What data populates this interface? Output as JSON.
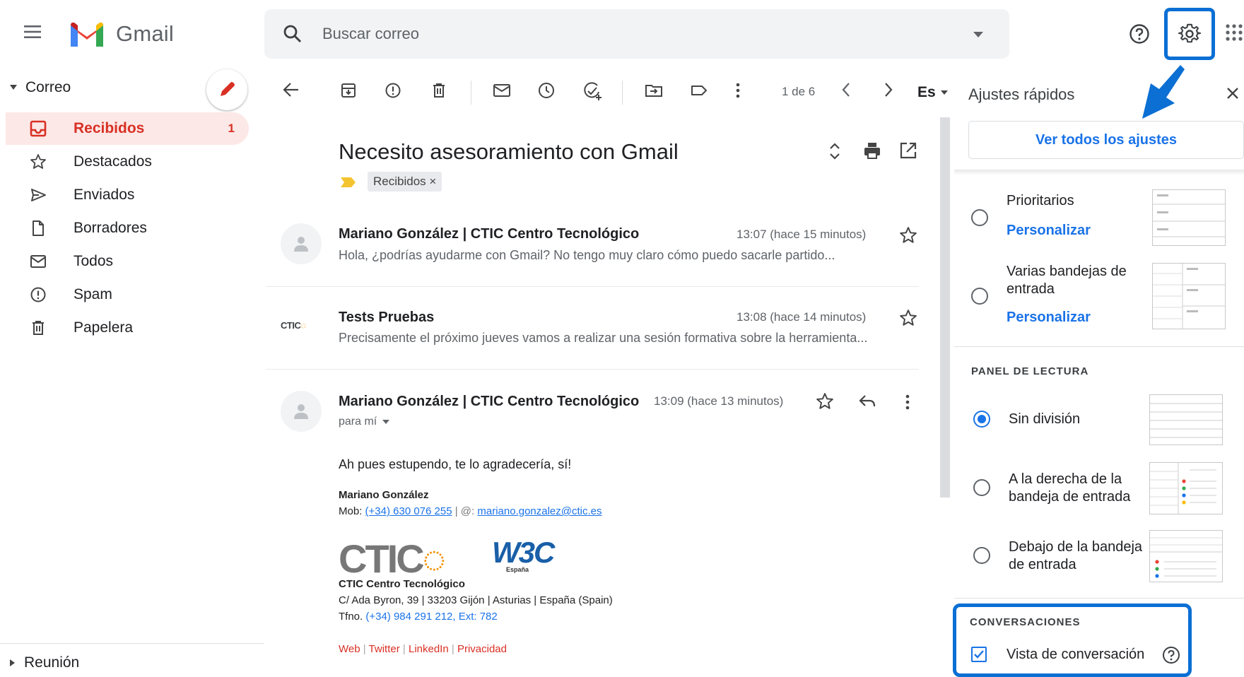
{
  "app": {
    "name": "Gmail"
  },
  "header": {
    "search_placeholder": "Buscar correo"
  },
  "sidebar": {
    "section_label": "Correo",
    "items": [
      {
        "label": "Recibidos",
        "count": "1",
        "icon": "inbox-icon",
        "active": true
      },
      {
        "label": "Destacados",
        "icon": "star-icon"
      },
      {
        "label": "Enviados",
        "icon": "send-icon"
      },
      {
        "label": "Borradores",
        "icon": "draft-icon"
      },
      {
        "label": "Todos",
        "icon": "all-mail-icon"
      },
      {
        "label": "Spam",
        "icon": "spam-icon"
      },
      {
        "label": "Papelera",
        "icon": "trash-icon"
      }
    ],
    "meet_label": "Reunión"
  },
  "toolbar": {
    "pager": "1 de 6",
    "language": "Es"
  },
  "thread": {
    "subject": "Necesito asesoramiento con Gmail",
    "label": "Recibidos ×",
    "messages": [
      {
        "sender": "Mariano González | CTIC Centro Tecnológico",
        "time": "13:07 (hace 15 minutos)",
        "snippet": "Hola, ¿podrías ayudarme con Gmail? No tengo muy claro cómo puedo sacarle partido..."
      },
      {
        "sender": "Tests Pruebas",
        "time": "13:08 (hace 14 minutos)",
        "snippet": "Precisamente el próximo jueves vamos a realizar una sesión formativa sobre la herramienta...",
        "avatar_text": "CTIC"
      },
      {
        "sender": "Mariano González | CTIC Centro Tecnológico",
        "time": "13:09 (hace 13 minutos)",
        "to": "para mí",
        "body": "Ah pues estupendo, te lo agradecería, sí!"
      }
    ],
    "signature": {
      "name": "Mariano González",
      "mob_label": "Mob:",
      "mob_phone": "(+34) 630 076 255",
      "at_sep": "| @:",
      "email": "mariano.gonzalez@ctic.es",
      "logo_text": "CTIC",
      "w3c_text": "W3C",
      "w3c_sub": "España",
      "org": "CTIC Centro Tecnológico",
      "address": "C/ Ada Byron, 39  | 33203 Gijón  |  Asturias  |  España (Spain)",
      "tfno_label": "Tfno.",
      "tfno": "(+34) 984 291 212, Ext: 782",
      "links": [
        "Web",
        "Twitter",
        "LinkedIn",
        "Privacidad"
      ]
    }
  },
  "quick_settings": {
    "title": "Ajustes rápidos",
    "see_all": "Ver todos los ajustes",
    "inbox_types": [
      {
        "label": "Prioritarios",
        "link": "Personalizar"
      },
      {
        "label": "Varias bandejas de entrada",
        "link": "Personalizar"
      }
    ],
    "reading_pane": {
      "heading": "PANEL DE LECTURA",
      "options": [
        {
          "label": "Sin división",
          "selected": true
        },
        {
          "label": "A la derecha de la bandeja de entrada"
        },
        {
          "label": "Debajo de la bandeja de entrada"
        }
      ]
    },
    "conversations": {
      "heading": "CONVERSACIONES",
      "label": "Vista de conversación",
      "checked": true
    }
  },
  "colors": {
    "accent_red": "#d93025",
    "accent_blue": "#1a73e8",
    "highlight_blue": "#0b6fd4"
  }
}
